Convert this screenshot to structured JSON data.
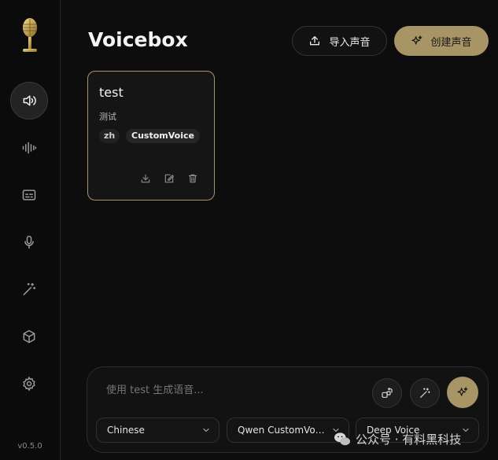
{
  "app": {
    "title": "Voicebox",
    "version": "v0.5.0"
  },
  "sidebar": {
    "items": [
      {
        "icon": "speaker-icon",
        "active": true
      },
      {
        "icon": "waveform-icon",
        "active": false
      },
      {
        "icon": "captions-icon",
        "active": false
      },
      {
        "icon": "microphone-icon",
        "active": false
      },
      {
        "icon": "magic-wand-icon",
        "active": false
      },
      {
        "icon": "box-icon",
        "active": false
      },
      {
        "icon": "gear-icon",
        "active": false
      }
    ]
  },
  "header": {
    "import_label": "导入声音",
    "create_label": "创建声音"
  },
  "voices": [
    {
      "name": "test",
      "description": "测试",
      "language": "zh",
      "model": "CustomVoice"
    }
  ],
  "composer": {
    "placeholder": "使用 test 生成语音...",
    "language": "Chinese",
    "model": "Qwen CustomVoic...",
    "style": "Deep Voice"
  },
  "watermark": {
    "text": "公众号 · 有料黑科技"
  },
  "colors": {
    "accent": "#a89566",
    "background": "#0d0d0d"
  }
}
